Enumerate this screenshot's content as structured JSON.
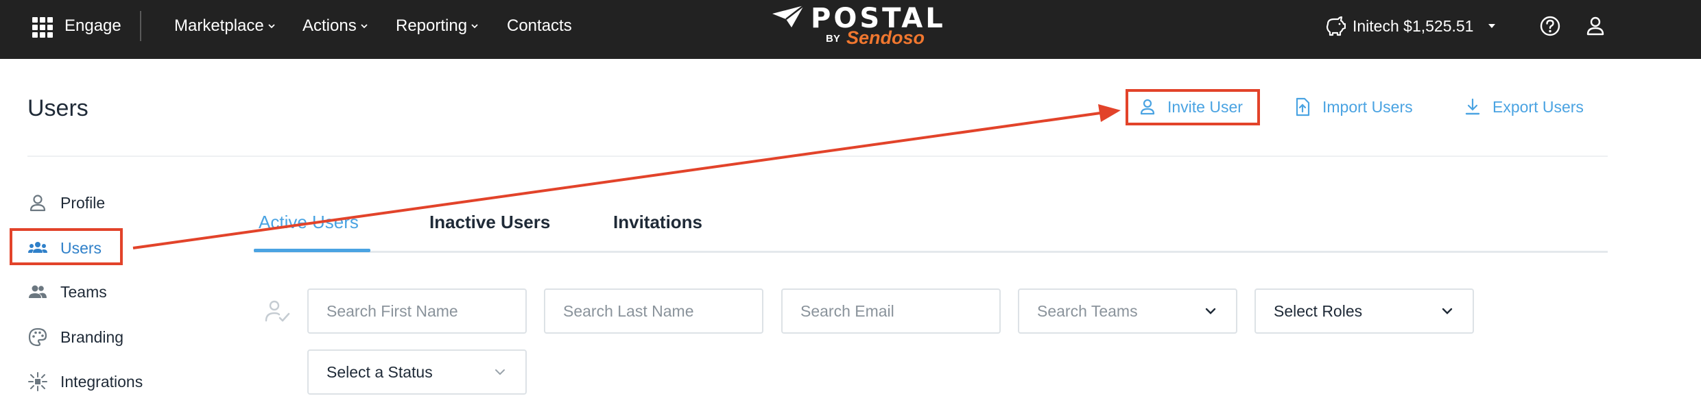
{
  "topbar": {
    "app_name": "Engage",
    "nav": [
      {
        "label": "Marketplace",
        "has_dropdown": true
      },
      {
        "label": "Actions",
        "has_dropdown": true
      },
      {
        "label": "Reporting",
        "has_dropdown": true
      },
      {
        "label": "Contacts",
        "has_dropdown": false
      }
    ],
    "logo": {
      "word": "POSTAL",
      "by": "BY",
      "brand": "Sendoso"
    },
    "balance": "Initech $1,525.51",
    "icons": [
      "apps-grid-icon",
      "piggy-bank-icon",
      "help-icon",
      "user-icon"
    ]
  },
  "page": {
    "title": "Users",
    "actions": [
      {
        "label": "Invite User",
        "icon": "user-outline-icon"
      },
      {
        "label": "Import Users",
        "icon": "file-upload-icon"
      },
      {
        "label": "Export Users",
        "icon": "download-icon"
      }
    ]
  },
  "sidebar": {
    "items": [
      {
        "label": "Profile",
        "icon": "person-icon",
        "active": false
      },
      {
        "label": "Users",
        "icon": "users-group-icon",
        "active": true
      },
      {
        "label": "Teams",
        "icon": "team-icon",
        "active": false
      },
      {
        "label": "Branding",
        "icon": "palette-icon",
        "active": false
      },
      {
        "label": "Integrations",
        "icon": "integrations-icon",
        "active": false
      }
    ]
  },
  "tabs": [
    {
      "label": "Active Users",
      "active": true
    },
    {
      "label": "Inactive Users",
      "active": false
    },
    {
      "label": "Invitations",
      "active": false
    }
  ],
  "filters": {
    "first_name_placeholder": "Search First Name",
    "last_name_placeholder": "Search Last Name",
    "email_placeholder": "Search Email",
    "teams_placeholder": "Search Teams",
    "roles_label": "Select Roles",
    "status_label": "Select a Status"
  },
  "colors": {
    "topbar_bg": "#222222",
    "accent_blue": "#4aa3e2",
    "brand_orange": "#f0772f",
    "annotation_red": "#e2432a"
  }
}
